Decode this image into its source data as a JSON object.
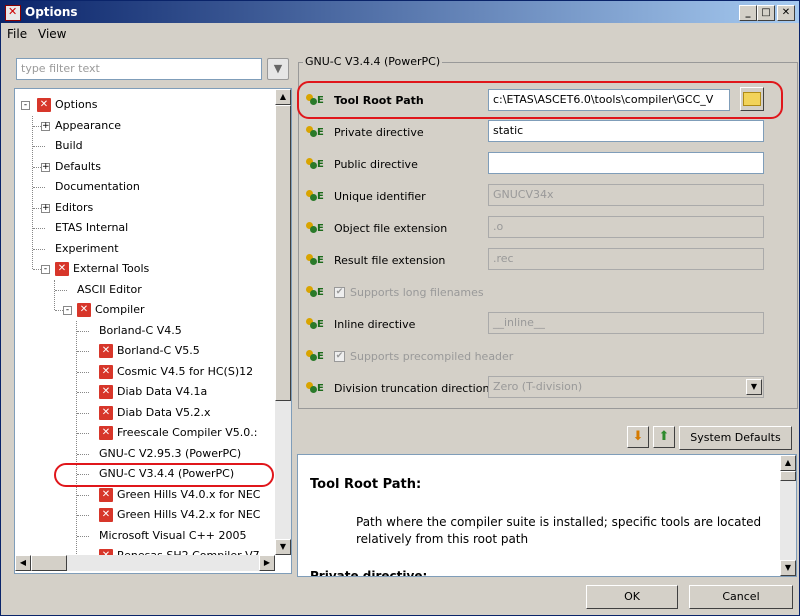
{
  "window": {
    "title": "Options"
  },
  "menu": [
    "File",
    "View"
  ],
  "filter": {
    "placeholder": "type filter text"
  },
  "tree": [
    {
      "label": "Options",
      "level": 0,
      "expander": "-",
      "icon": "red-x"
    },
    {
      "label": "Appearance",
      "level": 1,
      "expander": "+"
    },
    {
      "label": "Build",
      "level": 1
    },
    {
      "label": "Defaults",
      "level": 1,
      "expander": "+"
    },
    {
      "label": "Documentation",
      "level": 1
    },
    {
      "label": "Editors",
      "level": 1,
      "expander": "+"
    },
    {
      "label": "ETAS Internal",
      "level": 1
    },
    {
      "label": "Experiment",
      "level": 1
    },
    {
      "label": "External Tools",
      "level": 1,
      "expander": "-",
      "icon": "red-x"
    },
    {
      "label": "ASCII Editor",
      "level": 2
    },
    {
      "label": "Compiler",
      "level": 2,
      "expander": "-",
      "icon": "red-x"
    },
    {
      "label": "Borland-C V4.5",
      "level": 3
    },
    {
      "label": "Borland-C V5.5",
      "level": 3,
      "icon": "red-x"
    },
    {
      "label": "Cosmic V4.5 for HC(S)12",
      "level": 3,
      "icon": "red-x"
    },
    {
      "label": "Diab Data V4.1a",
      "level": 3,
      "icon": "red-x"
    },
    {
      "label": "Diab Data V5.2.x",
      "level": 3,
      "icon": "red-x"
    },
    {
      "label": "Freescale Compiler V5.0.:",
      "level": 3,
      "icon": "red-x"
    },
    {
      "label": "GNU-C V2.95.3 (PowerPC)",
      "level": 3
    },
    {
      "label": "GNU-C V3.4.4 (PowerPC)",
      "level": 3
    },
    {
      "label": "Green Hills V4.0.x for NEC",
      "level": 3,
      "icon": "red-x"
    },
    {
      "label": "Green Hills V4.2.x for NEC",
      "level": 3,
      "icon": "red-x"
    },
    {
      "label": "Microsoft Visual C++ 2005",
      "level": 3
    },
    {
      "label": "Renesas SH2 Compiler V7",
      "level": 3,
      "icon": "red-x"
    }
  ],
  "group": {
    "title": "GNU-C V3.4.4 (PowerPC)"
  },
  "props": {
    "tool_root_path": {
      "label": "Tool Root Path",
      "value": "c:\\ETAS\\ASCET6.0\\tools\\compiler\\GCC_V"
    },
    "private_directive": {
      "label": "Private directive",
      "value": "static"
    },
    "public_directive": {
      "label": "Public directive",
      "value": ""
    },
    "unique_identifier": {
      "label": "Unique identifier",
      "value": "GNUCV34x"
    },
    "object_file_extension": {
      "label": "Object file extension",
      "value": ".o"
    },
    "result_file_extension": {
      "label": "Result file extension",
      "value": ".rec"
    },
    "supports_long_filenames": {
      "label": "Supports long filenames",
      "checked": true
    },
    "inline_directive": {
      "label": "Inline directive",
      "value": "__inline__"
    },
    "supports_precompiled_header": {
      "label": "Supports precompiled header",
      "checked": true
    },
    "division_truncation": {
      "label": "Division truncation direction",
      "value": "Zero (T-division)"
    }
  },
  "buttons": {
    "system_defaults": "System Defaults",
    "ok": "OK",
    "cancel": "Cancel"
  },
  "help": {
    "title": "Tool Root Path:",
    "body": "Path where the compiler suite is installed; specific tools are located relatively from this root path",
    "next_heading": "Private directive:"
  },
  "colors": {
    "highlight": "#e0161b",
    "titlebar": "#0a246a"
  }
}
